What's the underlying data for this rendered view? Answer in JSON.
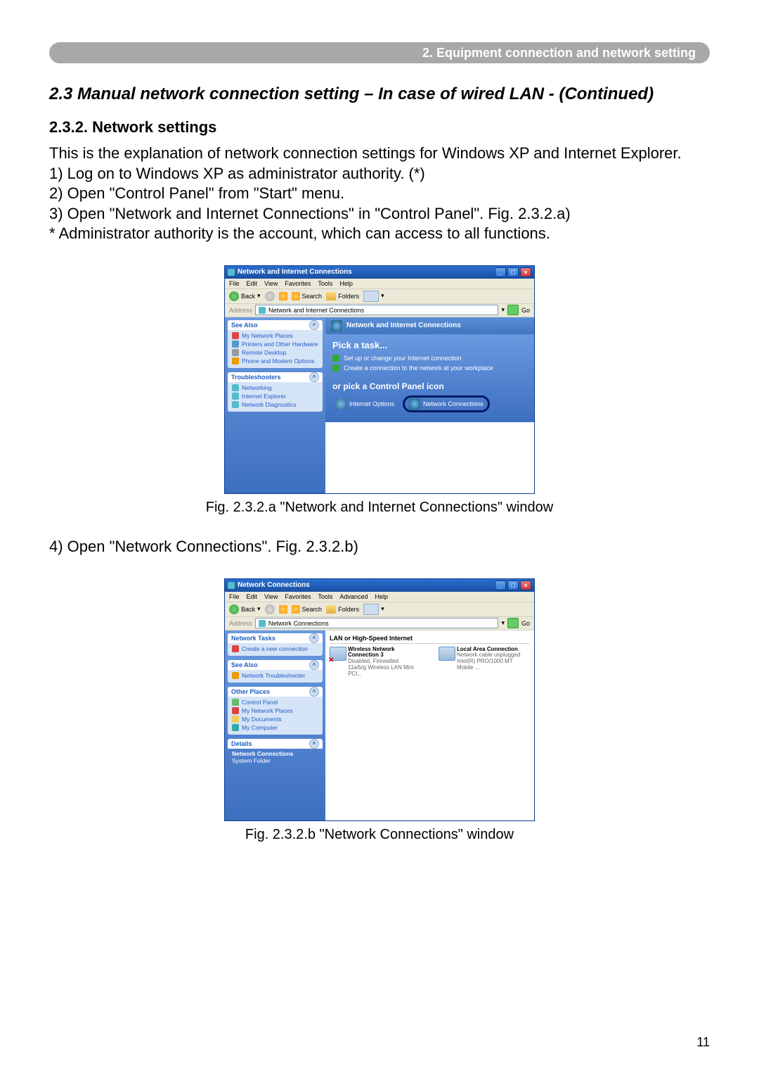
{
  "chapter_bar": "2. Equipment connection and network setting",
  "section_title": "2.3 Manual network connection setting – In case of wired LAN - (Continued)",
  "subsection_title": "2.3.2. Network settings",
  "intro": "This is the explanation of network connection settings for Windows XP and Internet Explorer.",
  "steps": {
    "s1": "1) Log on to Windows XP as administrator authority. (*)",
    "s2": "2) Open \"Control Panel\" from \"Start\" menu.",
    "s3": "3) Open \"Network and Internet Connections\" in \"Control Panel\". Fig. 2.3.2.a)",
    "note": "* Administrator authority is the account, which can access to all functions.",
    "s4": "4) Open \"Network Connections\". Fig. 2.3.2.b)"
  },
  "fig_a_caption": "Fig. 2.3.2.a \"Network and Internet Connections\" window",
  "fig_b_caption": "Fig. 2.3.2.b \"Network Connections\" window",
  "page_number": "11",
  "win_a": {
    "title": "Network and Internet Connections",
    "menus": [
      "File",
      "Edit",
      "View",
      "Favorites",
      "Tools",
      "Help"
    ],
    "toolbar": {
      "back": "Back",
      "search": "Search",
      "folders": "Folders"
    },
    "address_label": "Address",
    "address_value": "Network and Internet Connections",
    "go": "Go",
    "side_see_also": "See Also",
    "see_also_links": [
      "My Network Places",
      "Printers and Other Hardware",
      "Remote Desktop",
      "Phone and Modem Options"
    ],
    "side_trouble": "Troubleshooters",
    "trouble_links": [
      "Networking",
      "Internet Explorer",
      "Network Diagnostics"
    ],
    "header": "Network and Internet Connections",
    "pick": "Pick a task...",
    "tasks": [
      "Set up or change your Internet connection",
      "Create a connection to the network at your workplace"
    ],
    "or_pick": "or pick a Control Panel icon",
    "cp_internet": "Internet Options",
    "cp_network": "Network Connections"
  },
  "win_b": {
    "title": "Network Connections",
    "menus": [
      "File",
      "Edit",
      "View",
      "Favorites",
      "Tools",
      "Advanced",
      "Help"
    ],
    "toolbar": {
      "back": "Back",
      "search": "Search",
      "folders": "Folders"
    },
    "address_label": "Address",
    "address_value": "Network Connections",
    "go": "Go",
    "side_tasks_head": "Network Tasks",
    "side_tasks": [
      "Create a new connection"
    ],
    "side_see_also": "See Also",
    "see_also_links": [
      "Network Troubleshooter"
    ],
    "side_other": "Other Places",
    "other_links": [
      "Control Panel",
      "My Network Places",
      "My Documents",
      "My Computer"
    ],
    "side_details": "Details",
    "details_name": "Network Connections",
    "details_sub": "System Folder",
    "category": "LAN or High-Speed Internet",
    "conn1": {
      "name": "Wireless Network Connection 3",
      "sub1": "Disabled, Firewalled",
      "sub2": "11a/b/g Wireless LAN Mini PCI..."
    },
    "conn2": {
      "name": "Local Area Connection",
      "sub1": "Network cable unplugged",
      "sub2": "Intel(R) PRO/1000 MT Mobile ..."
    }
  }
}
